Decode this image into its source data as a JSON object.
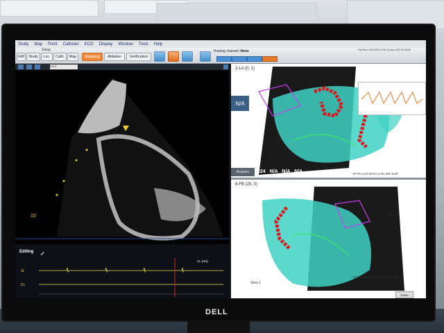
{
  "menu": [
    "Study",
    "Map",
    "Point",
    "Catheter",
    "ECG",
    "Display",
    "Window",
    "Tools",
    "Help"
  ],
  "toolbar": {
    "setup_label": "Setup",
    "tabs": [
      "HW",
      "Study",
      "Loc.",
      "Cath.",
      "Map",
      "Mapping",
      "Ablation",
      "Verification"
    ],
    "active_tab": "Mapping",
    "rowing_label": "Rowing channel:",
    "rowing_value": "None",
    "topright_text": "File Time 14/1/2000 12:04 13-Mar-2019 10:26:52"
  },
  "ultrasound": {
    "selector_value": "2-LA",
    "depth_marker": "10"
  },
  "ecg": {
    "editing_label": "Editing",
    "track1_label": "11",
    "track2_label": "CL",
    "cl_label": "CL (ms)"
  },
  "map_top": {
    "title": "2-LA (0, 1)",
    "na_box": "N/A",
    "acquire_label": "Acquire",
    "values": [
      "224",
      "N/A",
      "N/A",
      "N/A"
    ],
    "view_labels": "AP PA LAO RAO LL RL INF SUP"
  },
  "map_bottom": {
    "title": "9-FB (25, 0)",
    "lat_label": "LAT",
    "view_label": "View 1",
    "close_label": "Close",
    "view_labels": "AP PA LAO RAO LL RL INF SUP"
  },
  "brand": "DELL",
  "colors": {
    "orange_tab": "#f08a3c",
    "mesh_cyan": "#3fd1c4",
    "ablation_red": "#e0141c",
    "catheter_green": "#3fe56a",
    "mesh_magenta": "#c93df0"
  }
}
